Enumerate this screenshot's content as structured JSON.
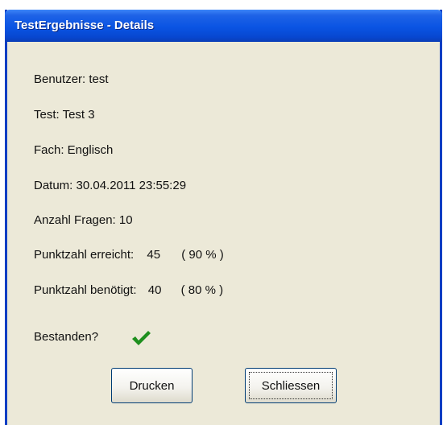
{
  "window": {
    "title": "TestErgebnisse - Details"
  },
  "details": {
    "user": "Benutzer: test",
    "test": "Test:  Test 3",
    "subject": "Fach:  Englisch",
    "date": "Datum:  30.04.2011 23:55:29",
    "question_count": "Anzahl Fragen:   10",
    "score_reached_label": "Punktzahl erreicht:",
    "score_reached_value": "45",
    "score_reached_percent": "( 90 % )",
    "score_required_label": "Punktzahl benötigt:",
    "score_required_value": "40",
    "score_required_percent": "( 80 % )",
    "passed_label": "Bestanden?",
    "passed_icon": "checkmark-icon",
    "passed_color": "#1e8f1e"
  },
  "buttons": {
    "print_label": "Drucken",
    "close_label": "Schliessen"
  }
}
